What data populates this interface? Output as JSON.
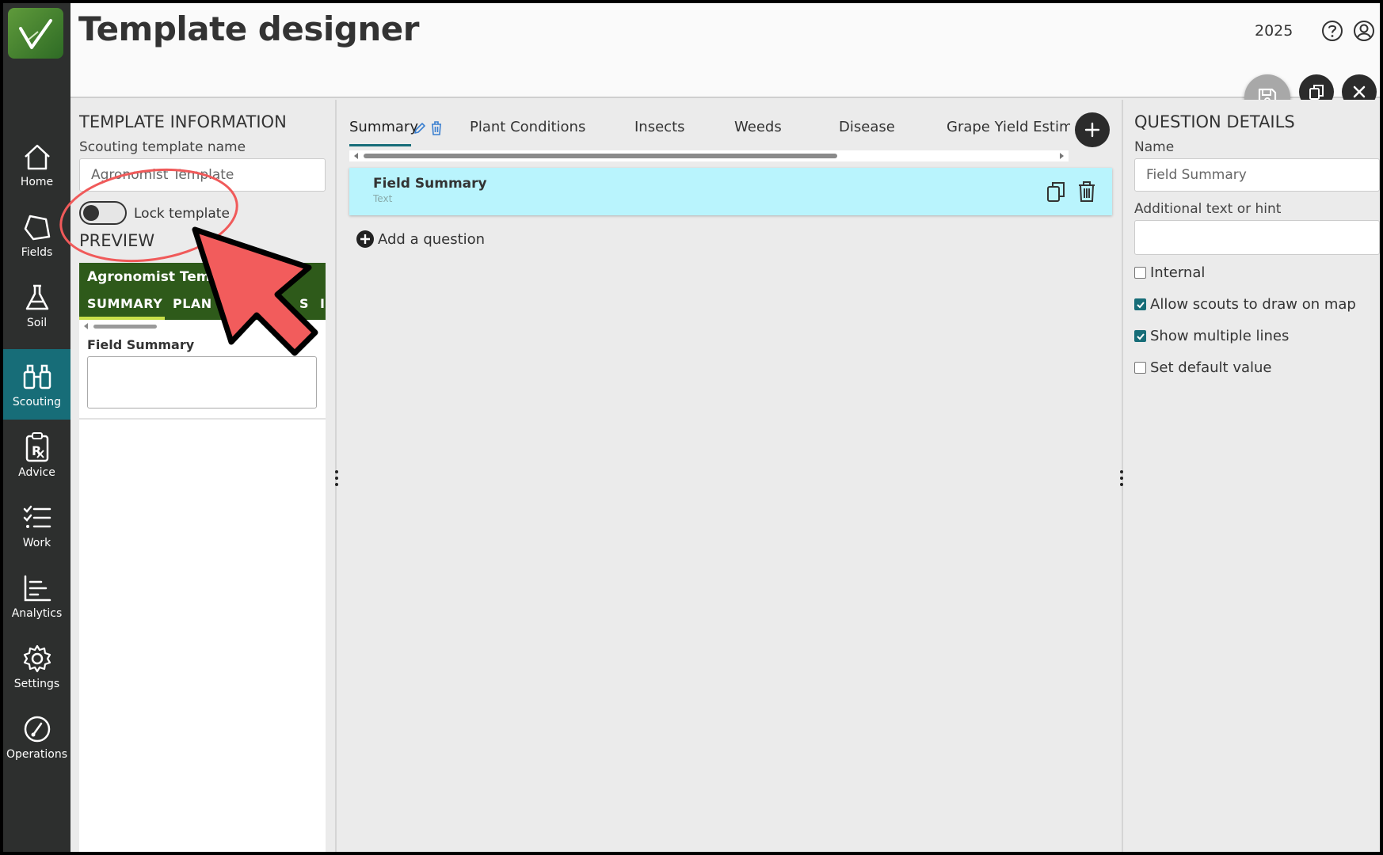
{
  "header": {
    "title": "Template designer",
    "year": "2025"
  },
  "sidebar": {
    "items": [
      {
        "label": "Home",
        "icon": "home-icon"
      },
      {
        "label": "Fields",
        "icon": "field-shape-icon"
      },
      {
        "label": "Soil",
        "icon": "flask-icon"
      },
      {
        "label": "Scouting",
        "icon": "binoculars-icon",
        "active": true
      },
      {
        "label": "Advice",
        "icon": "prescription-clipboard-icon"
      },
      {
        "label": "Work",
        "icon": "checklist-icon"
      },
      {
        "label": "Analytics",
        "icon": "bar-chart-icon"
      },
      {
        "label": "Settings",
        "icon": "gear-icon"
      },
      {
        "label": "Operations",
        "icon": "gauge-icon"
      }
    ]
  },
  "template_info": {
    "heading": "TEMPLATE INFORMATION",
    "name_label": "Scouting template name",
    "name_value": "Agronomist Template",
    "lock_label": "Lock template",
    "lock_on": false
  },
  "preview": {
    "heading": "PREVIEW",
    "title": "Agronomist Temp",
    "tabs": [
      "SUMMARY",
      "PLAN",
      "S",
      "I"
    ],
    "field_label": "Field Summary"
  },
  "tabs": [
    {
      "label": "Summary",
      "active": true
    },
    {
      "label": "Plant Conditions"
    },
    {
      "label": "Insects"
    },
    {
      "label": "Weeds"
    },
    {
      "label": "Disease"
    },
    {
      "label": "Grape Yield Estimat"
    }
  ],
  "questions": [
    {
      "name": "Field Summary",
      "type": "Text"
    }
  ],
  "add_question_label": "Add a question",
  "question_details": {
    "heading": "QUESTION DETAILS",
    "name_label": "Name",
    "name_value": "Field Summary",
    "hint_label": "Additional text or hint",
    "hint_value": "",
    "options": [
      {
        "label": "Internal",
        "checked": false
      },
      {
        "label": "Allow scouts to draw on map",
        "checked": true
      },
      {
        "label": "Show multiple lines",
        "checked": true
      },
      {
        "label": "Set default value",
        "checked": false
      }
    ]
  },
  "colors": {
    "accent": "#176d78",
    "sidebar": "#2d2f2e",
    "card": "#b9f4fd",
    "preview_header": "#2e5a1a",
    "annotation": "#f05a5a"
  }
}
